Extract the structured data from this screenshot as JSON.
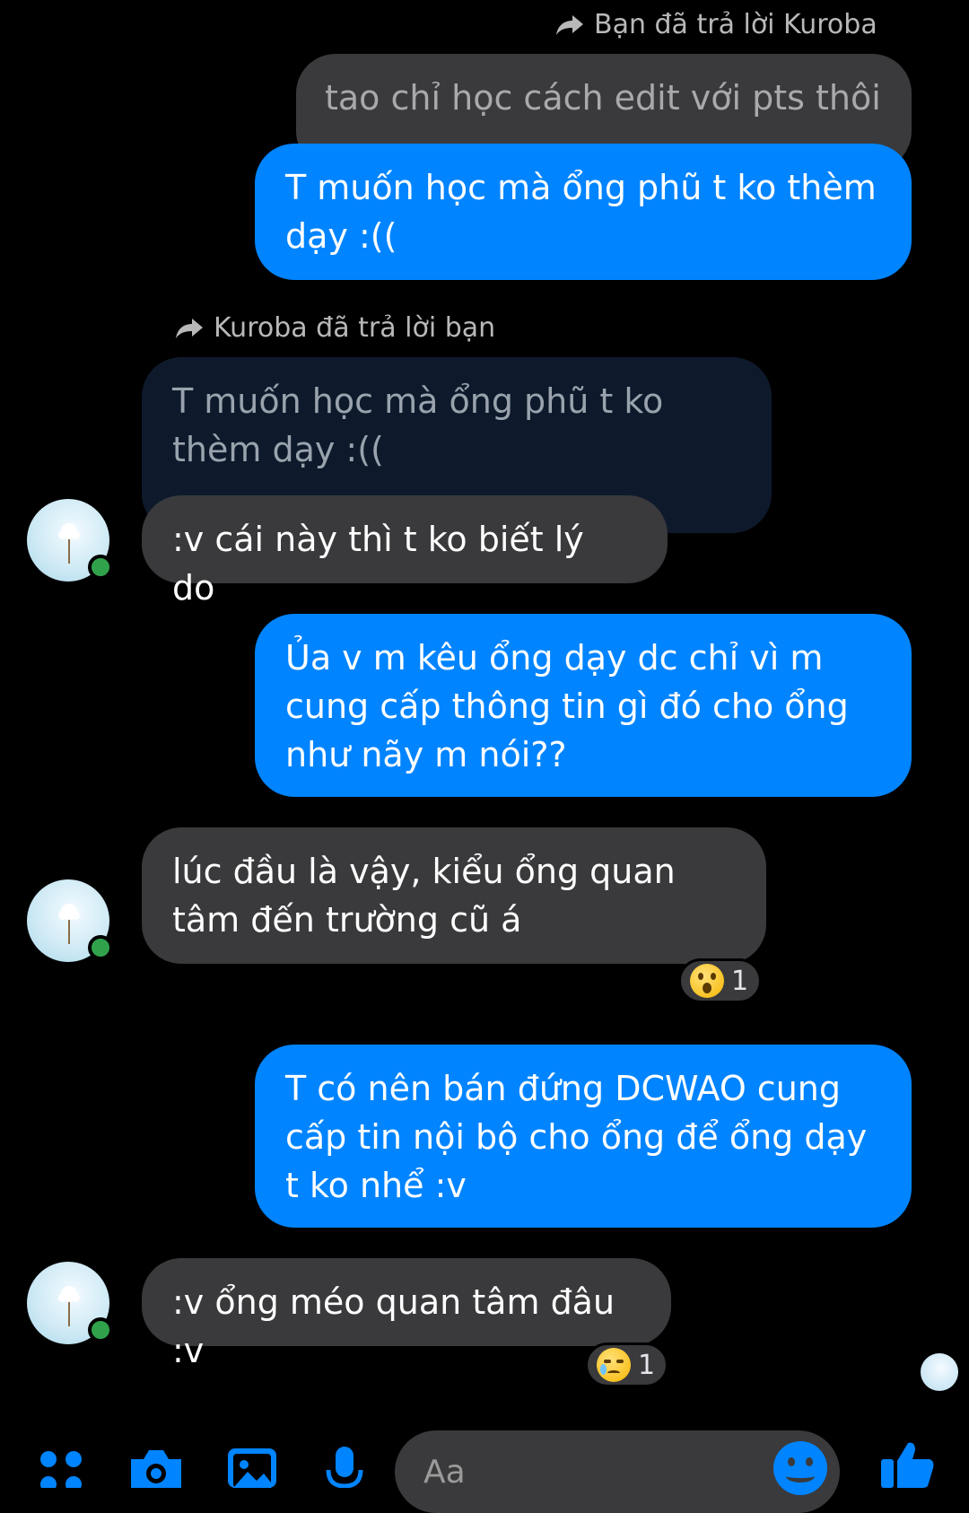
{
  "thread": {
    "reply_you_to_kuroba": "Bạn đã trả lời Kuroba",
    "quoted_1": "tao chỉ học cách edit với pts thôi",
    "msg_1": "T muốn học mà ổng phũ t ko thèm dạy :((",
    "reply_kuroba_to_you": "Kuroba đã trả lời bạn",
    "quoted_2": "T muốn học mà ổng phũ t ko thèm dạy :((",
    "msg_2": ":v cái này thì t ko biết lý do",
    "msg_3": "Ủa v m kêu ổng dạy dc chỉ vì m cung cấp thông tin gì đó cho ổng như nãy m nói??",
    "msg_4": "lúc đầu là vậy, kiểu ổng quan tâm đến trường cũ á",
    "reaction_4_emoji": "surprised-face",
    "reaction_4_count": "1",
    "msg_5": "T có nên bán đứng DCWAO cung cấp tin nội bộ cho ổng để ổng dạy t ko nhể :v",
    "msg_6": ":v ổng méo quan tâm đâu :v",
    "reaction_6_emoji": "crying-face",
    "reaction_6_count": "1"
  },
  "composer": {
    "placeholder": "Aa"
  },
  "colors": {
    "sent_bubble": "#0084ff",
    "received_bubble": "#3a3a3c",
    "accent": "#0084ff",
    "online": "#31a24c"
  }
}
